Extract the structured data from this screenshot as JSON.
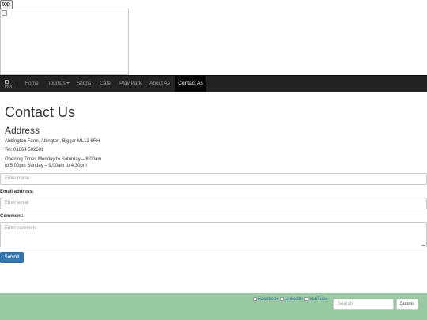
{
  "top_button": {
    "label": "top"
  },
  "banner": {
    "image_alt": ""
  },
  "navbar": {
    "brand_alt": "Hon",
    "items": [
      {
        "label": "Home"
      },
      {
        "label": "Tourists"
      },
      {
        "label": "Shops"
      },
      {
        "label": "Cafe"
      },
      {
        "label": "Play Park"
      },
      {
        "label": "About As"
      },
      {
        "label": "Contact As"
      }
    ],
    "active_item": "Contact As"
  },
  "contact": {
    "title": "Contact Us",
    "address_heading": "Address",
    "address": "Abbington Farm, Abington, Biggar ML12 6RH",
    "tel": "Tel: 01864 502501",
    "hours_line1": "Opening Times Monday to Saturday – 8.00am",
    "hours_line2": "to 5.00pm Sunday – 9.00am to 4.30pm"
  },
  "form": {
    "name_placeholder": "Enter name",
    "email_label": "Email address:",
    "email_placeholder": "Enter email",
    "comment_label": "Comment:",
    "comment_placeholder": "Enter comment",
    "submit_label": "Submit"
  },
  "footer": {
    "social": [
      {
        "alt": "Facebook"
      },
      {
        "alt": "LinkedIn"
      },
      {
        "alt": "YouTube"
      }
    ],
    "search_placeholder": "Search",
    "search_button": "Submit"
  },
  "colors": {
    "navbar_bg": "#222222",
    "footer_bg": "#98c9a3",
    "primary": "#337ab7"
  }
}
